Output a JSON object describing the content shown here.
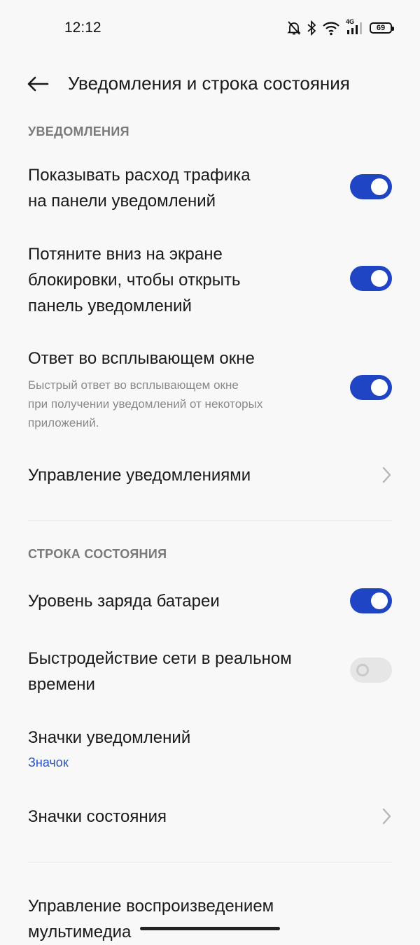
{
  "status_bar": {
    "time": "12:12",
    "network_label": "4G",
    "battery": "69"
  },
  "header": {
    "back_icon": "arrow-left-icon",
    "title": "Уведомления и строка состояния"
  },
  "notifications_section": {
    "title": "УВЕДОМЛЕНИЯ",
    "items": [
      {
        "line1": "Показывать расход трафика",
        "line2": "на панели уведомлений",
        "toggle": "on"
      },
      {
        "line1": "Потяните вниз на экране",
        "line2": "блокировки, чтобы открыть",
        "line3": "панель уведомлений",
        "toggle": "on"
      },
      {
        "title": "Ответ во всплывающем окне",
        "sub1": "Быстрый ответ во всплывающем окне",
        "sub2": "при получении уведомлений от некоторых",
        "sub3": "приложений.",
        "toggle": "on"
      },
      {
        "title": "Управление уведомлениями",
        "icon": "chevron-right-icon"
      }
    ]
  },
  "status_section": {
    "title": "СТРОКА СОСТОЯНИЯ",
    "items": [
      {
        "title": "Уровень заряда батареи",
        "toggle": "on"
      },
      {
        "line1": "Быстродействие сети в реальном",
        "line2": "времени",
        "toggle": "off"
      },
      {
        "title": "Значки уведомлений",
        "value": "Значок"
      },
      {
        "title": "Значки состояния",
        "icon": "chevron-right-icon"
      }
    ]
  },
  "media_section": {
    "line1": "Управление воспроизведением",
    "line2": "мультимедиа"
  },
  "colors": {
    "accent": "#1f45c5",
    "link": "#2a52be",
    "background": "#f8f8f8"
  }
}
